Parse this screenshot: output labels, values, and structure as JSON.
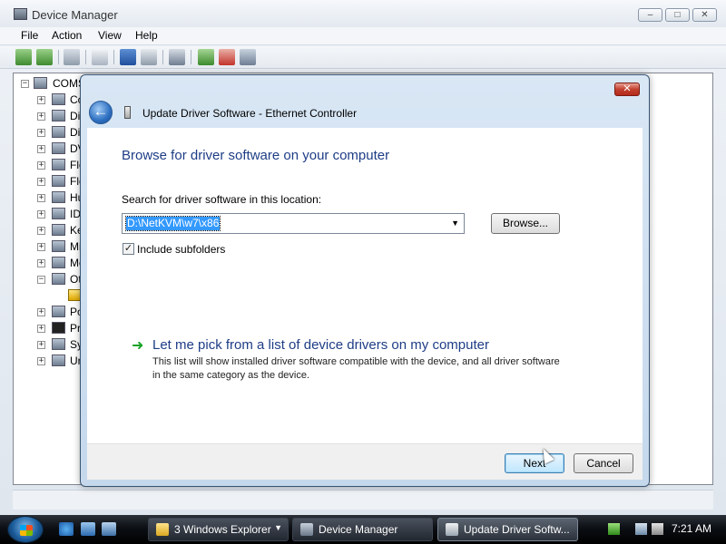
{
  "device_manager": {
    "title": "Device Manager",
    "window_buttons": [
      "–",
      "□",
      "✕"
    ],
    "menu": [
      "File",
      "Action",
      "View",
      "Help"
    ],
    "tree": {
      "root": "COMS",
      "items": [
        "Co",
        "Di",
        "Di",
        "DV",
        "Flo",
        "Flo",
        "Hu",
        "ID",
        "Ke",
        "Mi",
        "Mo",
        "Ot",
        "",
        "Po",
        "Pr",
        "Sy",
        "Ur"
      ]
    }
  },
  "wizard": {
    "title": "Update Driver Software - Ethernet Controller",
    "close_label": "✕",
    "heading": "Browse for driver software on your computer",
    "search_label": "Search for driver software in this location:",
    "path_value": "D:\\NetKVM\\w7\\x86",
    "browse_label": "Browse...",
    "include_subfolders_label": "Include subfolders",
    "include_subfolders_checked": true,
    "pick_link": "Let me pick from a list of device drivers on my computer",
    "pick_description": "This list will show installed driver software compatible with the device, and all driver software in the same category as the device.",
    "next_label": "Next",
    "cancel_label": "Cancel"
  },
  "taskbar": {
    "buttons": [
      {
        "label": "3 Windows Explorer",
        "icon": "folder-icon"
      },
      {
        "label": "Device Manager",
        "icon": "device-manager-icon"
      },
      {
        "label": "Update Driver Softw...",
        "icon": "update-driver-icon"
      }
    ],
    "clock": "7:21 AM"
  },
  "colors": {
    "accent": "#1e3d86",
    "selection": "#3399ff",
    "close_red": "#c3402f"
  }
}
